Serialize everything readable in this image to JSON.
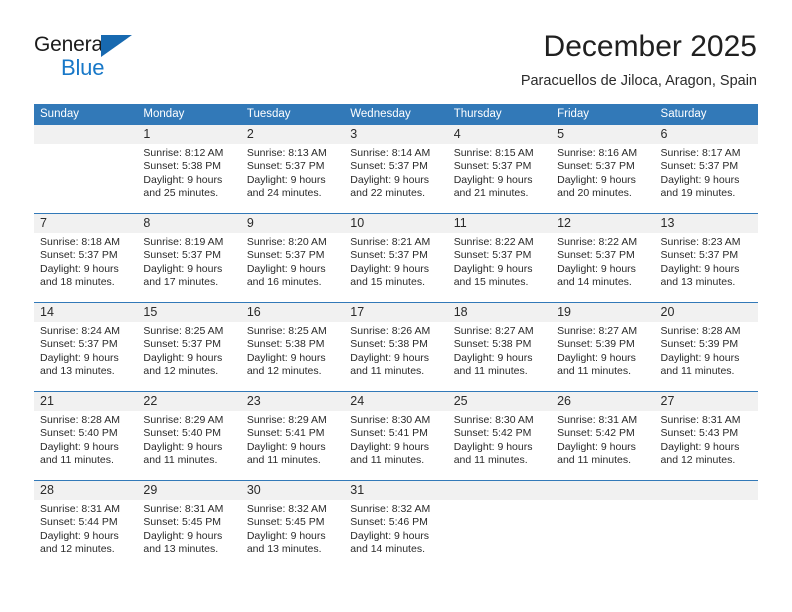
{
  "logo": {
    "word_one": "General",
    "word_two": "Blue",
    "triangle_color": "#1769b0",
    "blue_text_color": "#1878c8"
  },
  "header": {
    "title": "December 2025",
    "subtitle": "Paracuellos de Jiloca, Aragon, Spain"
  },
  "theme": {
    "header_blue": "#3279b8",
    "daynum_strip": "#f1f1f1",
    "text": "#2a2a2a"
  },
  "calendar": {
    "day_names": [
      "Sunday",
      "Monday",
      "Tuesday",
      "Wednesday",
      "Thursday",
      "Friday",
      "Saturday"
    ],
    "weeks": [
      [
        {
          "day": "",
          "sunrise": "",
          "sunset": "",
          "daylight_1": "",
          "daylight_2": ""
        },
        {
          "day": "1",
          "sunrise": "Sunrise: 8:12 AM",
          "sunset": "Sunset: 5:38 PM",
          "daylight_1": "Daylight: 9 hours",
          "daylight_2": "and 25 minutes."
        },
        {
          "day": "2",
          "sunrise": "Sunrise: 8:13 AM",
          "sunset": "Sunset: 5:37 PM",
          "daylight_1": "Daylight: 9 hours",
          "daylight_2": "and 24 minutes."
        },
        {
          "day": "3",
          "sunrise": "Sunrise: 8:14 AM",
          "sunset": "Sunset: 5:37 PM",
          "daylight_1": "Daylight: 9 hours",
          "daylight_2": "and 22 minutes."
        },
        {
          "day": "4",
          "sunrise": "Sunrise: 8:15 AM",
          "sunset": "Sunset: 5:37 PM",
          "daylight_1": "Daylight: 9 hours",
          "daylight_2": "and 21 minutes."
        },
        {
          "day": "5",
          "sunrise": "Sunrise: 8:16 AM",
          "sunset": "Sunset: 5:37 PM",
          "daylight_1": "Daylight: 9 hours",
          "daylight_2": "and 20 minutes."
        },
        {
          "day": "6",
          "sunrise": "Sunrise: 8:17 AM",
          "sunset": "Sunset: 5:37 PM",
          "daylight_1": "Daylight: 9 hours",
          "daylight_2": "and 19 minutes."
        }
      ],
      [
        {
          "day": "7",
          "sunrise": "Sunrise: 8:18 AM",
          "sunset": "Sunset: 5:37 PM",
          "daylight_1": "Daylight: 9 hours",
          "daylight_2": "and 18 minutes."
        },
        {
          "day": "8",
          "sunrise": "Sunrise: 8:19 AM",
          "sunset": "Sunset: 5:37 PM",
          "daylight_1": "Daylight: 9 hours",
          "daylight_2": "and 17 minutes."
        },
        {
          "day": "9",
          "sunrise": "Sunrise: 8:20 AM",
          "sunset": "Sunset: 5:37 PM",
          "daylight_1": "Daylight: 9 hours",
          "daylight_2": "and 16 minutes."
        },
        {
          "day": "10",
          "sunrise": "Sunrise: 8:21 AM",
          "sunset": "Sunset: 5:37 PM",
          "daylight_1": "Daylight: 9 hours",
          "daylight_2": "and 15 minutes."
        },
        {
          "day": "11",
          "sunrise": "Sunrise: 8:22 AM",
          "sunset": "Sunset: 5:37 PM",
          "daylight_1": "Daylight: 9 hours",
          "daylight_2": "and 15 minutes."
        },
        {
          "day": "12",
          "sunrise": "Sunrise: 8:22 AM",
          "sunset": "Sunset: 5:37 PM",
          "daylight_1": "Daylight: 9 hours",
          "daylight_2": "and 14 minutes."
        },
        {
          "day": "13",
          "sunrise": "Sunrise: 8:23 AM",
          "sunset": "Sunset: 5:37 PM",
          "daylight_1": "Daylight: 9 hours",
          "daylight_2": "and 13 minutes."
        }
      ],
      [
        {
          "day": "14",
          "sunrise": "Sunrise: 8:24 AM",
          "sunset": "Sunset: 5:37 PM",
          "daylight_1": "Daylight: 9 hours",
          "daylight_2": "and 13 minutes."
        },
        {
          "day": "15",
          "sunrise": "Sunrise: 8:25 AM",
          "sunset": "Sunset: 5:37 PM",
          "daylight_1": "Daylight: 9 hours",
          "daylight_2": "and 12 minutes."
        },
        {
          "day": "16",
          "sunrise": "Sunrise: 8:25 AM",
          "sunset": "Sunset: 5:38 PM",
          "daylight_1": "Daylight: 9 hours",
          "daylight_2": "and 12 minutes."
        },
        {
          "day": "17",
          "sunrise": "Sunrise: 8:26 AM",
          "sunset": "Sunset: 5:38 PM",
          "daylight_1": "Daylight: 9 hours",
          "daylight_2": "and 11 minutes."
        },
        {
          "day": "18",
          "sunrise": "Sunrise: 8:27 AM",
          "sunset": "Sunset: 5:38 PM",
          "daylight_1": "Daylight: 9 hours",
          "daylight_2": "and 11 minutes."
        },
        {
          "day": "19",
          "sunrise": "Sunrise: 8:27 AM",
          "sunset": "Sunset: 5:39 PM",
          "daylight_1": "Daylight: 9 hours",
          "daylight_2": "and 11 minutes."
        },
        {
          "day": "20",
          "sunrise": "Sunrise: 8:28 AM",
          "sunset": "Sunset: 5:39 PM",
          "daylight_1": "Daylight: 9 hours",
          "daylight_2": "and 11 minutes."
        }
      ],
      [
        {
          "day": "21",
          "sunrise": "Sunrise: 8:28 AM",
          "sunset": "Sunset: 5:40 PM",
          "daylight_1": "Daylight: 9 hours",
          "daylight_2": "and 11 minutes."
        },
        {
          "day": "22",
          "sunrise": "Sunrise: 8:29 AM",
          "sunset": "Sunset: 5:40 PM",
          "daylight_1": "Daylight: 9 hours",
          "daylight_2": "and 11 minutes."
        },
        {
          "day": "23",
          "sunrise": "Sunrise: 8:29 AM",
          "sunset": "Sunset: 5:41 PM",
          "daylight_1": "Daylight: 9 hours",
          "daylight_2": "and 11 minutes."
        },
        {
          "day": "24",
          "sunrise": "Sunrise: 8:30 AM",
          "sunset": "Sunset: 5:41 PM",
          "daylight_1": "Daylight: 9 hours",
          "daylight_2": "and 11 minutes."
        },
        {
          "day": "25",
          "sunrise": "Sunrise: 8:30 AM",
          "sunset": "Sunset: 5:42 PM",
          "daylight_1": "Daylight: 9 hours",
          "daylight_2": "and 11 minutes."
        },
        {
          "day": "26",
          "sunrise": "Sunrise: 8:31 AM",
          "sunset": "Sunset: 5:42 PM",
          "daylight_1": "Daylight: 9 hours",
          "daylight_2": "and 11 minutes."
        },
        {
          "day": "27",
          "sunrise": "Sunrise: 8:31 AM",
          "sunset": "Sunset: 5:43 PM",
          "daylight_1": "Daylight: 9 hours",
          "daylight_2": "and 12 minutes."
        }
      ],
      [
        {
          "day": "28",
          "sunrise": "Sunrise: 8:31 AM",
          "sunset": "Sunset: 5:44 PM",
          "daylight_1": "Daylight: 9 hours",
          "daylight_2": "and 12 minutes."
        },
        {
          "day": "29",
          "sunrise": "Sunrise: 8:31 AM",
          "sunset": "Sunset: 5:45 PM",
          "daylight_1": "Daylight: 9 hours",
          "daylight_2": "and 13 minutes."
        },
        {
          "day": "30",
          "sunrise": "Sunrise: 8:32 AM",
          "sunset": "Sunset: 5:45 PM",
          "daylight_1": "Daylight: 9 hours",
          "daylight_2": "and 13 minutes."
        },
        {
          "day": "31",
          "sunrise": "Sunrise: 8:32 AM",
          "sunset": "Sunset: 5:46 PM",
          "daylight_1": "Daylight: 9 hours",
          "daylight_2": "and 14 minutes."
        },
        {
          "day": "",
          "sunrise": "",
          "sunset": "",
          "daylight_1": "",
          "daylight_2": ""
        },
        {
          "day": "",
          "sunrise": "",
          "sunset": "",
          "daylight_1": "",
          "daylight_2": ""
        },
        {
          "day": "",
          "sunrise": "",
          "sunset": "",
          "daylight_1": "",
          "daylight_2": ""
        }
      ]
    ]
  }
}
